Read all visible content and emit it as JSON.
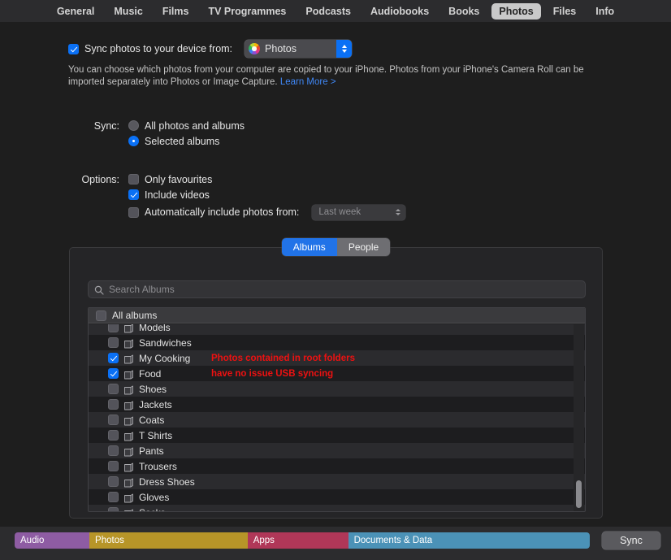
{
  "tabbar": {
    "items": [
      {
        "label": "General",
        "selected": false
      },
      {
        "label": "Music",
        "selected": false
      },
      {
        "label": "Films",
        "selected": false
      },
      {
        "label": "TV Programmes",
        "selected": false
      },
      {
        "label": "Podcasts",
        "selected": false
      },
      {
        "label": "Audiobooks",
        "selected": false
      },
      {
        "label": "Books",
        "selected": false
      },
      {
        "label": "Photos",
        "selected": true
      },
      {
        "label": "Files",
        "selected": false
      },
      {
        "label": "Info",
        "selected": false
      }
    ]
  },
  "sync_header": {
    "checkbox_label": "Sync photos to your device from:",
    "checked": true,
    "source_popup": {
      "value": "Photos",
      "icon": "photos-app-icon"
    }
  },
  "description": {
    "text": "You can choose which photos from your computer are copied to your iPhone. Photos from your iPhone's Camera Roll can be imported separately into Photos or Image Capture. ",
    "link_text": "Learn More >"
  },
  "sync_group": {
    "label": "Sync:",
    "options": [
      {
        "label": "All photos and albums",
        "selected": false
      },
      {
        "label": "Selected albums",
        "selected": true
      }
    ]
  },
  "options_group": {
    "label": "Options:",
    "items": [
      {
        "label": "Only favourites",
        "checked": false
      },
      {
        "label": "Include videos",
        "checked": true
      },
      {
        "label": "Automatically include photos from:",
        "checked": false
      }
    ],
    "date_popup": {
      "value": "Last week",
      "enabled": false
    }
  },
  "panel": {
    "segments": [
      {
        "label": "Albums",
        "active": true
      },
      {
        "label": "People",
        "active": false
      }
    ],
    "search": {
      "placeholder": "Search Albums",
      "value": "",
      "icon": "search-icon"
    },
    "list_header": {
      "label": "All albums",
      "checked": false
    },
    "rows": [
      {
        "label": "Models",
        "checked": false,
        "clipped": true,
        "annotation": ""
      },
      {
        "label": "Sandwiches",
        "checked": false,
        "annotation": ""
      },
      {
        "label": "My Cooking",
        "checked": true,
        "annotation": "Photos contained in root folders"
      },
      {
        "label": "Food",
        "checked": true,
        "annotation": "have no issue USB syncing"
      },
      {
        "label": "Shoes",
        "checked": false,
        "annotation": ""
      },
      {
        "label": "Jackets",
        "checked": false,
        "annotation": ""
      },
      {
        "label": "Coats",
        "checked": false,
        "annotation": ""
      },
      {
        "label": "T Shirts",
        "checked": false,
        "annotation": ""
      },
      {
        "label": "Pants",
        "checked": false,
        "annotation": ""
      },
      {
        "label": "Trousers",
        "checked": false,
        "annotation": ""
      },
      {
        "label": "Dress Shoes",
        "checked": false,
        "annotation": ""
      },
      {
        "label": "Gloves",
        "checked": false,
        "annotation": ""
      },
      {
        "label": "Socks",
        "checked": false,
        "annotation": ""
      }
    ],
    "scrollbar": {
      "position": "bottom"
    }
  },
  "capacity_bar": {
    "segments": [
      {
        "label": "Audio",
        "color": "#8e5ca3",
        "width_pct": 13.0
      },
      {
        "label": "Photos",
        "color": "#b79528",
        "width_pct": 27.5
      },
      {
        "label": "Apps",
        "color": "#b03758",
        "width_pct": 17.5
      },
      {
        "label": "Documents & Data",
        "color": "#4b92b7",
        "width_pct": 42.0
      }
    ]
  },
  "sync_button": {
    "label": "Sync"
  }
}
